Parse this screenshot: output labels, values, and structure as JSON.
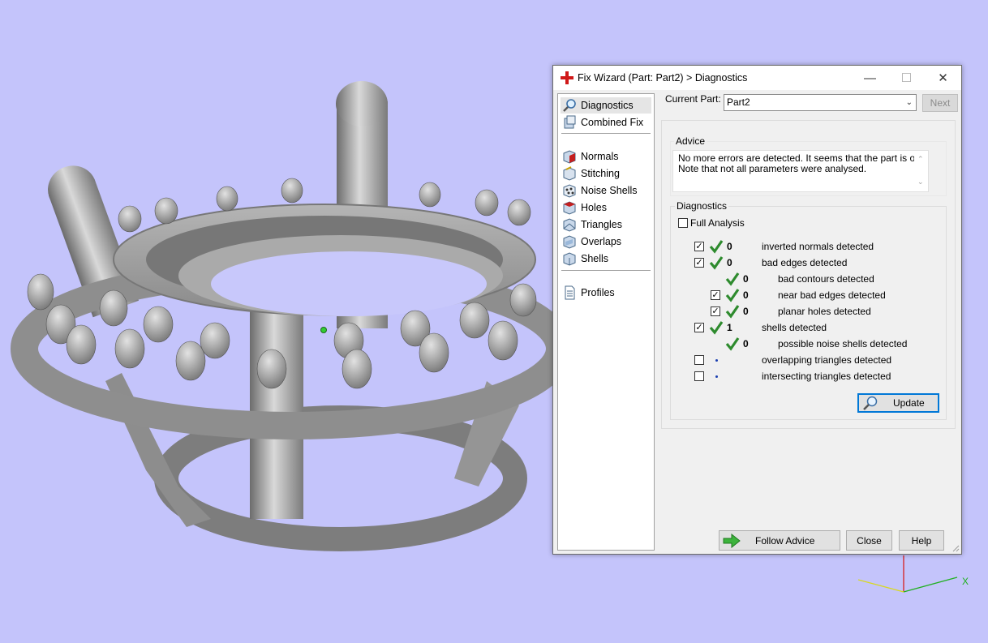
{
  "window": {
    "title": "Fix Wizard (Part: Part2) > Diagnostics",
    "controls": {
      "minimize": "—",
      "maximize": "☐",
      "close": "✕"
    }
  },
  "nav": {
    "items": [
      {
        "label": "Diagnostics",
        "icon": "magnifier-icon",
        "selected": true
      },
      {
        "label": "Combined Fix",
        "icon": "cube-stack-icon"
      },
      {
        "label": "Normals",
        "icon": "normals-cube-icon"
      },
      {
        "label": "Stitching",
        "icon": "stitching-icon"
      },
      {
        "label": "Noise Shells",
        "icon": "noise-shells-icon"
      },
      {
        "label": "Holes",
        "icon": "holes-cube-icon"
      },
      {
        "label": "Triangles",
        "icon": "triangles-cube-icon"
      },
      {
        "label": "Overlaps",
        "icon": "overlaps-cube-icon"
      },
      {
        "label": "Shells",
        "icon": "shells-cube-icon"
      },
      {
        "label": "Profiles",
        "icon": "document-icon"
      }
    ]
  },
  "current_part": {
    "label": "Current Part:",
    "value": "Part2",
    "next_label": "Next"
  },
  "advice": {
    "title": "Advice",
    "lines": [
      "No more errors are detected. It seems that the part is ok.",
      "Note that not all parameters were analysed."
    ]
  },
  "diagnostics": {
    "title": "Diagnostics",
    "full_analysis": {
      "label": "Full Analysis",
      "checked": false
    },
    "rows": [
      {
        "label": "inverted normals detected",
        "count": "0",
        "checked": true
      },
      {
        "label": "bad edges detected",
        "count": "0",
        "checked": true
      },
      {
        "label": "bad contours detected",
        "count": "0"
      },
      {
        "label": "near bad edges detected",
        "count": "0",
        "checked": true
      },
      {
        "label": "planar holes detected",
        "count": "0",
        "checked": true
      },
      {
        "label": "shells detected",
        "count": "1",
        "checked": true
      },
      {
        "label": "possible noise shells detected",
        "count": "0"
      },
      {
        "label": "overlapping triangles detected",
        "checked": false
      },
      {
        "label": "intersecting triangles detected",
        "checked": false
      }
    ],
    "update_label": "Update"
  },
  "footer": {
    "follow_advice": "Follow Advice",
    "close": "Close",
    "help": "Help"
  },
  "axis": {
    "x_label": "X"
  },
  "colors": {
    "viewport_bg": "#c4c4fb",
    "accent": "#0078d7",
    "check_green": "#2e8b2e",
    "model_gray": "#9a9a9a"
  }
}
